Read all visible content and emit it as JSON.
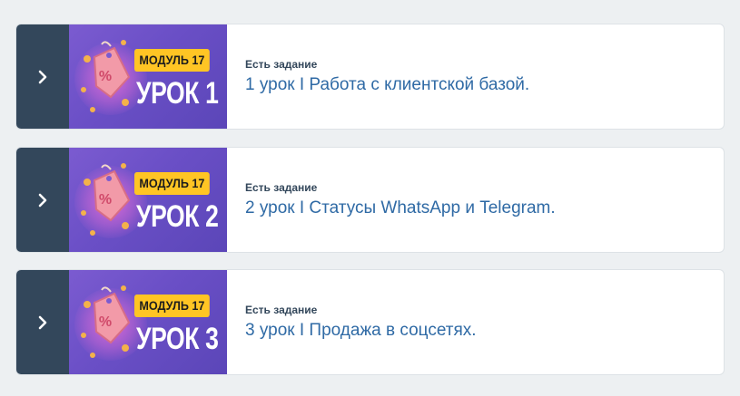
{
  "lessons": [
    {
      "module_badge": "МОДУЛЬ 17",
      "lesson_badge": "УРОК 1",
      "task_label": "Есть задание",
      "title": "1 урок I Работа с клиентской базой."
    },
    {
      "module_badge": "МОДУЛЬ 17",
      "lesson_badge": "УРОК 2",
      "task_label": "Есть задание",
      "title": "2 урок I Статусы WhatsApp и Telegram."
    },
    {
      "module_badge": "МОДУЛЬ 17",
      "lesson_badge": "УРОК 3",
      "task_label": "Есть задание",
      "title": "3 урок I Продажа в соцсетях."
    }
  ],
  "icons": {
    "toggle": "chevron-right-icon",
    "thumbnail_art": "discount-tag-icon"
  },
  "colors": {
    "background": "#edf0f2",
    "toggle_panel": "#33475b",
    "thumbnail": "#6a4fc6",
    "module_badge": "#ffc524",
    "title_link": "#2f6aa5"
  }
}
